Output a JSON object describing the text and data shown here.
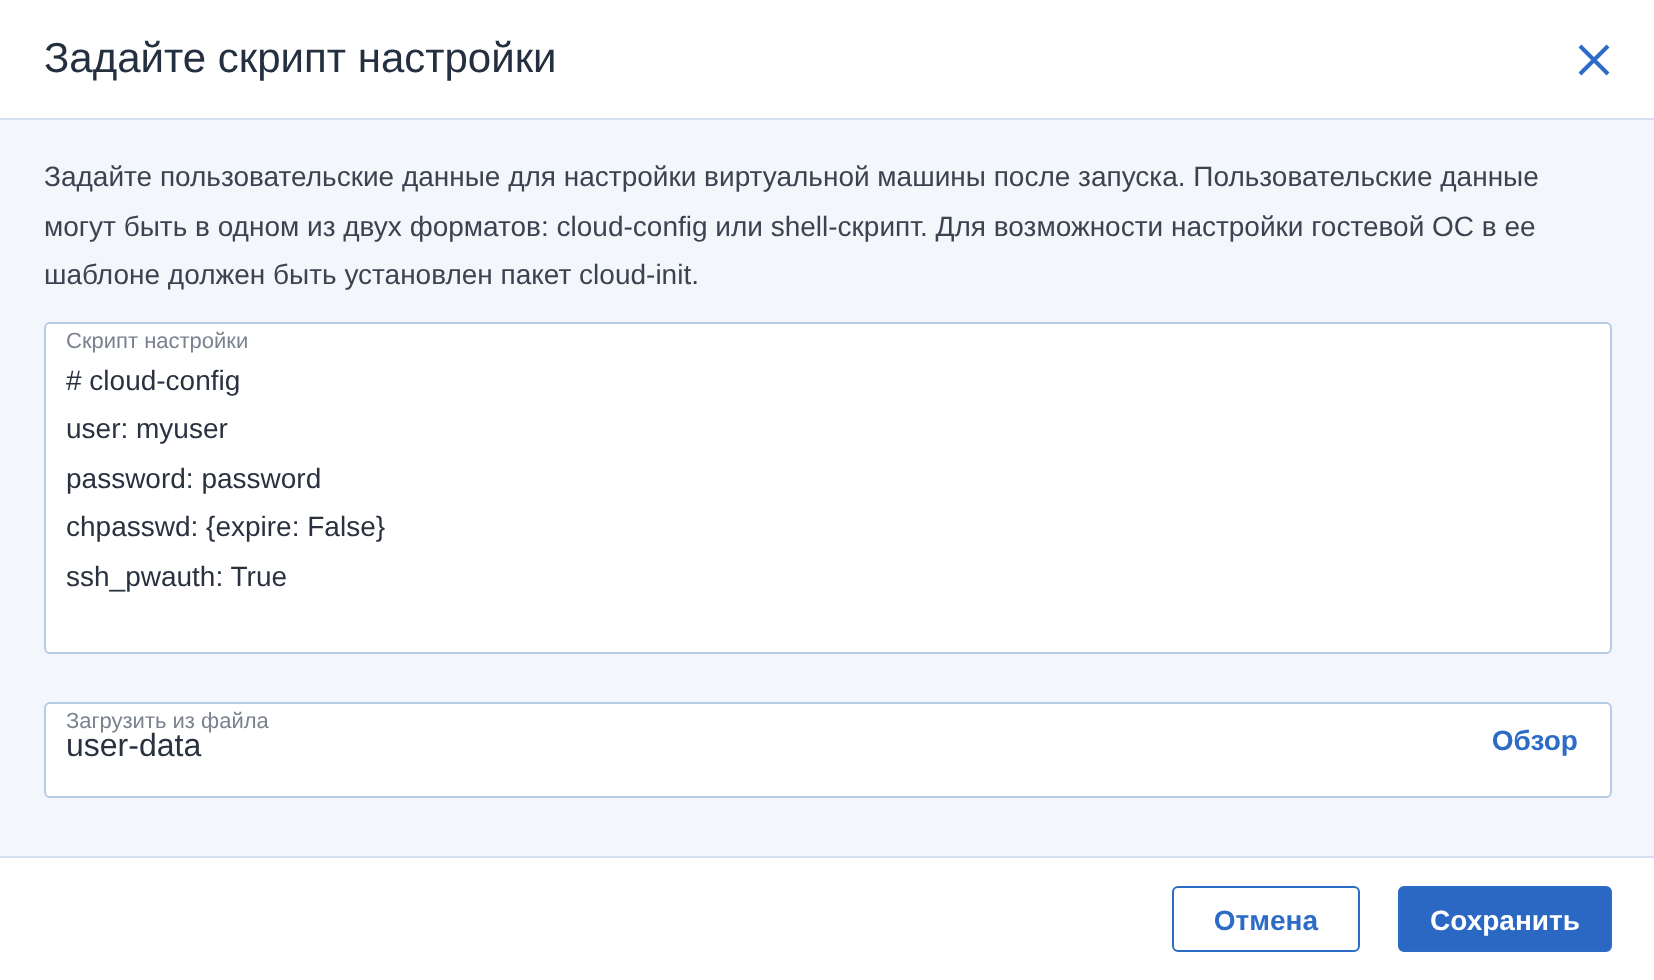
{
  "dialog": {
    "title": "Задайте скрипт настройки",
    "description": "Задайте пользовательские данные для настройки виртуальной машины после запуска. Пользовательские данные могут быть в одном из двух форматов: cloud-config или shell-скрипт. Для возможности настройки гостевой ОС в ее шаблоне должен быть установлен пакет cloud-init.",
    "script_field": {
      "label": "Скрипт настройки",
      "lines": [
        "# cloud-config",
        "user: myuser",
        "password: password",
        "chpasswd: {expire: False}",
        "ssh_pwauth: True"
      ]
    },
    "file_field": {
      "label": "Загрузить из файла",
      "value": "user-data",
      "browse": "Обзор"
    },
    "buttons": [
      {
        "label": "Отмена",
        "kind": "secondary"
      },
      {
        "label": "Сохранить",
        "kind": "primary"
      }
    ]
  }
}
